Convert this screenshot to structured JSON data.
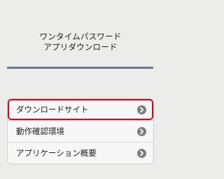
{
  "header": {
    "title_line1": "ワンタイムパスワード",
    "title_line2": "アプリダウンロード"
  },
  "menu": {
    "items": [
      {
        "label": "ダウンロードサイト",
        "icon": "chevron-right-circle-icon",
        "highlighted": true
      },
      {
        "label": "動作確認環境",
        "icon": "chevron-right-circle-icon",
        "highlighted": false
      },
      {
        "label": "アプリケーション概要",
        "icon": "chevron-right-circle-icon",
        "highlighted": false
      }
    ]
  },
  "colors": {
    "background": "#ececea",
    "divider": "#5c79a3",
    "highlight_border": "#e50012",
    "chevron": "#7d7d7d"
  }
}
